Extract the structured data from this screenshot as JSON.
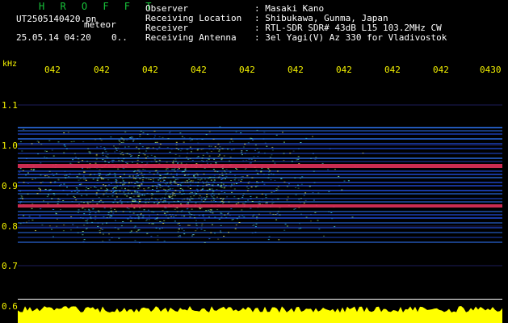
{
  "header": {
    "app_title": "H R O F F T",
    "file_name": "UT2505140420.pn",
    "meteor_label": "meteor",
    "timestamp": "25.05.14 04:20",
    "count": "0.."
  },
  "info": [
    {
      "label": "Observer",
      "value": ": Masaki Kano"
    },
    {
      "label": "Receiving Location",
      "value": ": Shibukawa, Gunma, Japan"
    },
    {
      "label": "Receiver",
      "value": ": RTL-SDR SDR# 43dB L15 103.2MHz CW"
    },
    {
      "label": "Receiving Antenna",
      "value": ": 3el Yagi(V) Az 330 for Vladivostok"
    }
  ],
  "axis": {
    "y_unit": "kHz",
    "x_ticks": [
      "042",
      "042",
      "042",
      "042",
      "042",
      "042",
      "042",
      "042",
      "042",
      "0430"
    ],
    "y_ticks": [
      "1.1",
      "1.0",
      "0.9",
      "0.8",
      "0.7",
      "0.6"
    ]
  },
  "colors": {
    "text": "#ffffff",
    "accent_green": "#18c43a",
    "axis_yellow": "#f5f300",
    "grid": "#1b1b5a"
  }
}
